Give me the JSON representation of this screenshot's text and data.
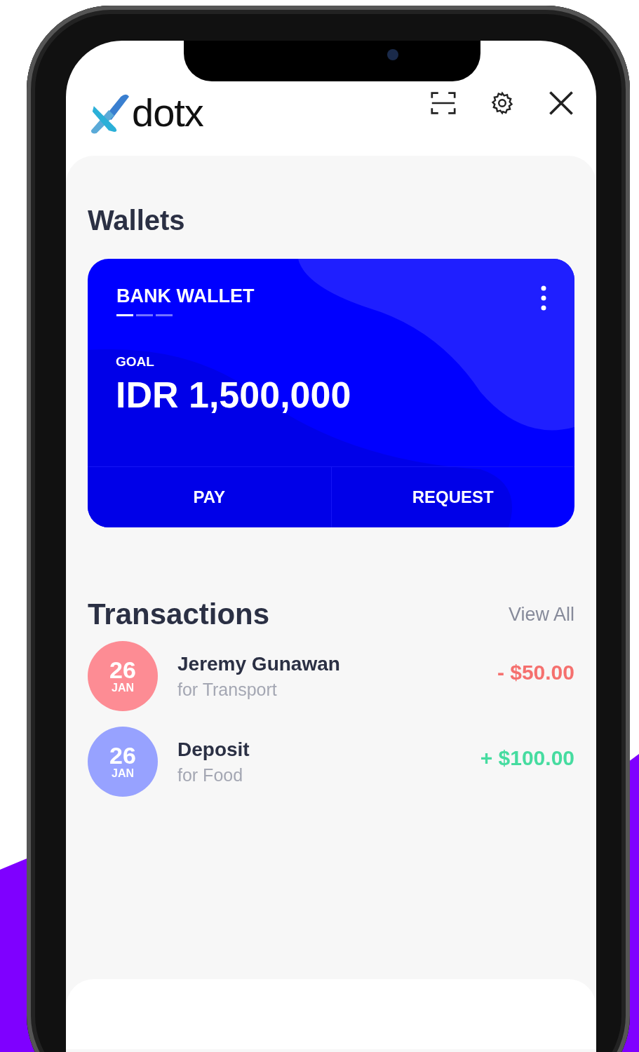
{
  "app": {
    "logo_text": "dotx"
  },
  "wallets": {
    "title": "Wallets",
    "card": {
      "name": "BANK WALLET",
      "pages": [
        {
          "selected": true
        },
        {
          "selected": false
        },
        {
          "selected": false
        }
      ],
      "goal_label": "GOAL",
      "goal_amount": "IDR 1,500,000",
      "actions": [
        "PAY",
        "REQUEST"
      ]
    }
  },
  "transactions": {
    "title": "Transactions",
    "view_all": "View All",
    "items": [
      {
        "day": "26",
        "month": "JAN",
        "name": "Jeremy Gunawan",
        "category": "for Transport",
        "amount": "- $50.00",
        "kind": "debit",
        "color": "#fd8c94"
      },
      {
        "day": "26",
        "month": "JAN",
        "name": "Deposit",
        "category": "for Food",
        "amount": "+ $100.00",
        "kind": "credit",
        "color": "#97a2ff"
      }
    ]
  }
}
